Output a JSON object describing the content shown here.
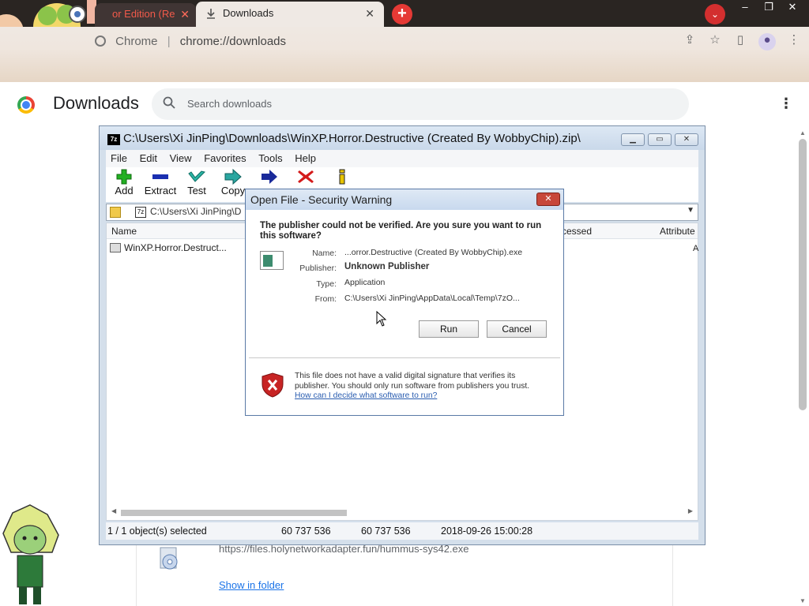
{
  "browser": {
    "tabs": [
      {
        "label": "or Edition (Re",
        "active": false
      },
      {
        "label": "Downloads",
        "active": true
      }
    ],
    "new_tab": "+",
    "window_buttons": [
      "–",
      "❐",
      "✕"
    ],
    "omnibox": {
      "site_label": "Chrome",
      "url": "chrome://downloads"
    }
  },
  "downloads_page": {
    "title": "Downloads",
    "search_placeholder": "Search downloads",
    "item": {
      "url": "https://files.holynetworkadapter.fun/hummus-sys42.exe",
      "show_in_folder": "Show in folder"
    }
  },
  "zip_window": {
    "title": "C:\\Users\\Xi JinPing\\Downloads\\WinXP.Horror.Destructive  (Created By WobbyChip).zip\\",
    "icon_label": "7z",
    "menu": [
      "File",
      "Edit",
      "View",
      "Favorites",
      "Tools",
      "Help"
    ],
    "toolbar": [
      "Add",
      "Extract",
      "Test",
      "Copy"
    ],
    "path": "C:\\Users\\Xi JinPing\\D",
    "columns": {
      "name": "Name",
      "accessed": "ccessed",
      "attributes": "Attribute"
    },
    "rows": [
      {
        "name": "WinXP.Horror.Destruct...",
        "attr": "A"
      }
    ],
    "status": {
      "selected": "1 / 1 object(s) selected",
      "size": "60 737 536",
      "packed": "60 737 536",
      "modified": "2018-09-26 15:00:28"
    }
  },
  "security_dialog": {
    "title": "Open File - Security Warning",
    "question": "The publisher could not be verified.  Are you sure you want to run this software?",
    "fields": [
      {
        "label": "Name:",
        "value": "...orror.Destructive  (Created By WobbyChip).exe"
      },
      {
        "label": "Publisher:",
        "value": "Unknown Publisher"
      },
      {
        "label": "Type:",
        "value": "Application"
      },
      {
        "label": "From:",
        "value": "C:\\Users\\Xi JinPing\\AppData\\Local\\Temp\\7zO..."
      }
    ],
    "run_button": "Run",
    "cancel_button": "Cancel",
    "note": "This file does not have a valid digital signature that verifies its publisher.  You should only run software from publishers you trust.",
    "link": "How can I decide what software to run?"
  },
  "colors": {
    "tabstrip": "#2a2522",
    "accent_red": "#e53935",
    "link_blue": "#1a73e8",
    "dialog_title": "#c8d9ee"
  }
}
